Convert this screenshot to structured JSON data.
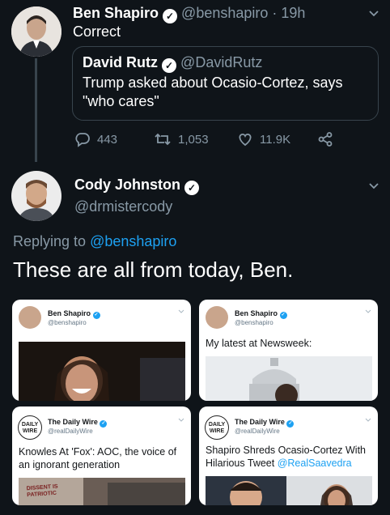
{
  "tweet1": {
    "name": "Ben Shapiro",
    "handle": "@benshapiro",
    "time": "· 19h",
    "text": "Correct",
    "quote": {
      "name": "David Rutz",
      "handle": "@DavidRutz",
      "text": "Trump asked about Ocasio-Cortez, says \"who cares\""
    },
    "actions": {
      "replies": "443",
      "retweets": "1,053",
      "likes": "11.9K"
    }
  },
  "tweet2": {
    "name": "Cody Johnston",
    "handle": "@drmistercody",
    "replying_prefix": "Replying to ",
    "replying_handle": "@benshapiro",
    "text": "These are all from today, Ben.",
    "cards": [
      {
        "name": "Ben Shapiro",
        "handle": "@benshapiro",
        "text": ""
      },
      {
        "name": "Ben Shapiro",
        "handle": "@benshapiro",
        "text": "My latest at Newsweek:"
      },
      {
        "name": "The Daily Wire",
        "handle": "@realDailyWire",
        "text": "Knowles At 'Fox': AOC, the voice of an ignorant generation",
        "sign": "DISSENT IS PATRIOTIC"
      },
      {
        "name": "The Daily Wire",
        "handle": "@realDailyWire",
        "text": "Shapiro Shreds Ocasio-Cortez With Hilarious Tweet ",
        "link": "@RealSaavedra"
      }
    ],
    "logo_text": "DAILY WIRE"
  },
  "icons": [
    "reply-icon",
    "retweet-icon",
    "like-icon",
    "share-icon",
    "verified-icon",
    "chevron-down-icon"
  ],
  "colors": {
    "background": "#0f1419",
    "link": "#1da1f2",
    "muted": "#8899a6",
    "border": "#38444d"
  }
}
